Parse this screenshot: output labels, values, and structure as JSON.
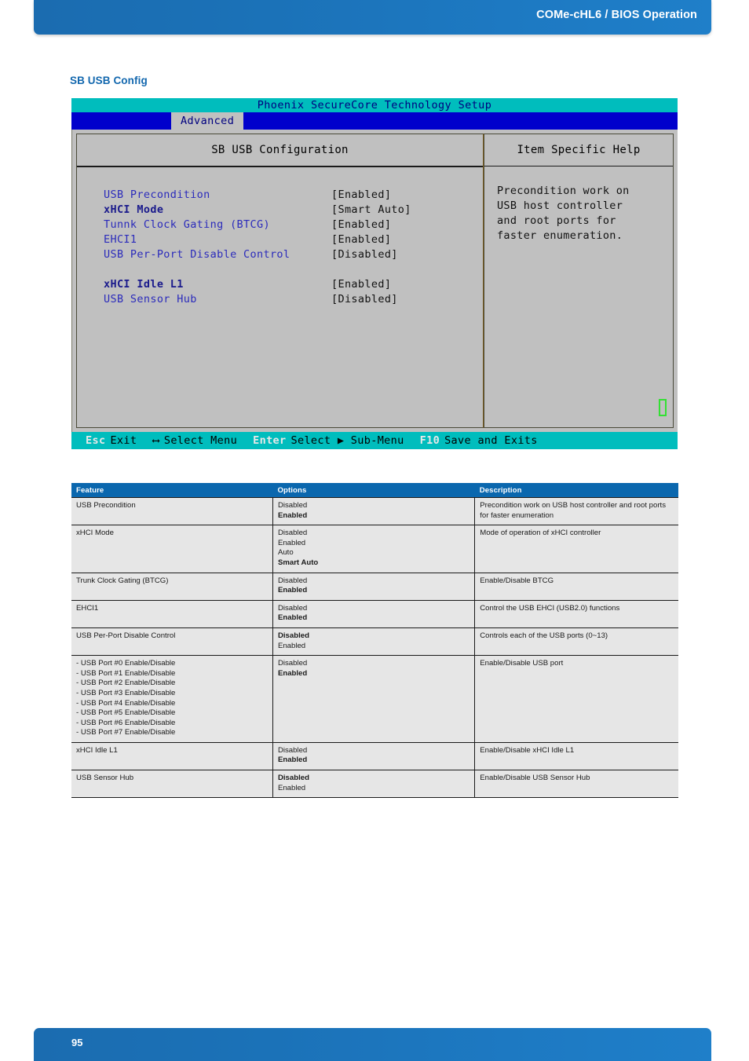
{
  "header": {
    "title": "COMe-cHL6 / BIOS Operation"
  },
  "section": {
    "heading": "SB USB Config"
  },
  "bios": {
    "titlebar": "Phoenix SecureCore Technology Setup",
    "active_tab": "Advanced",
    "left_panel_title": "SB USB Configuration",
    "right_panel_title": "Item Specific Help",
    "settings": [
      {
        "name": "USB Precondition",
        "value": "[Enabled]",
        "bold": false
      },
      {
        "name": "xHCI Mode",
        "value": "[Smart Auto]",
        "bold": true
      },
      {
        "name": "Tunnk Clock Gating (BTCG)",
        "value": "[Enabled]",
        "bold": false
      },
      {
        "name": "EHCI1",
        "value": "[Enabled]",
        "bold": false
      },
      {
        "name": "USB Per-Port Disable Control",
        "value": "[Disabled]",
        "bold": false
      },
      {
        "name": "",
        "value": "",
        "bold": false
      },
      {
        "name": "xHCI Idle L1",
        "value": "[Enabled]",
        "bold": true
      },
      {
        "name": "USB Sensor Hub",
        "value": "[Disabled]",
        "bold": false
      }
    ],
    "help_lines": [
      "Precondition work on",
      "USB host controller",
      "and root ports for",
      "faster enumeration."
    ],
    "footer": [
      {
        "key": "Esc",
        "label": "Exit"
      },
      {
        "key": "⟷",
        "label": "Select Menu"
      },
      {
        "key": "Enter",
        "label": "Select ▶ Sub-Menu"
      },
      {
        "key": "F10",
        "label": "Save and Exits"
      }
    ]
  },
  "table": {
    "columns": [
      "Feature",
      "Options",
      "Description"
    ],
    "rows": [
      {
        "feature": "USB Precondition",
        "options": [
          {
            "text": "Disabled",
            "bold": false
          },
          {
            "text": "Enabled",
            "bold": true
          }
        ],
        "description": "Precondition work on USB host controller and root ports for faster enumeration"
      },
      {
        "feature": "xHCI Mode",
        "options": [
          {
            "text": "Disabled",
            "bold": false
          },
          {
            "text": "Enabled",
            "bold": false
          },
          {
            "text": "Auto",
            "bold": false
          },
          {
            "text": "Smart Auto",
            "bold": true
          }
        ],
        "description": "Mode of operation of xHCI controller"
      },
      {
        "feature": "Trunk Clock Gating (BTCG)",
        "options": [
          {
            "text": "Disabled",
            "bold": false
          },
          {
            "text": "Enabled",
            "bold": true
          }
        ],
        "description": "Enable/Disable BTCG"
      },
      {
        "feature": "EHCI1",
        "options": [
          {
            "text": "Disabled",
            "bold": false
          },
          {
            "text": "Enabled",
            "bold": true
          }
        ],
        "description": "Control the USB EHCI (USB2.0) functions"
      },
      {
        "feature": "USB Per-Port Disable Control",
        "options": [
          {
            "text": "Disabled",
            "bold": true
          },
          {
            "text": "Enabled",
            "bold": false
          }
        ],
        "description": "Controls each of the USB ports (0~13)"
      },
      {
        "feature": "- USB Port #0 Enable/Disable\n- USB Port #1 Enable/Disable\n- USB Port #2 Enable/Disable\n- USB Port #3 Enable/Disable\n- USB Port #4 Enable/Disable\n- USB Port #5 Enable/Disable\n- USB Port #6 Enable/Disable\n- USB Port #7 Enable/Disable",
        "options": [
          {
            "text": "Disabled",
            "bold": false
          },
          {
            "text": "Enabled",
            "bold": true
          }
        ],
        "description": "Enable/Disable USB port"
      },
      {
        "feature": "xHCI Idle L1",
        "options": [
          {
            "text": "Disabled",
            "bold": false
          },
          {
            "text": "Enabled",
            "bold": true
          }
        ],
        "description": "Enable/Disable xHCI Idle L1"
      },
      {
        "feature": "USB Sensor Hub",
        "options": [
          {
            "text": "Disabled",
            "bold": true
          },
          {
            "text": "Enabled",
            "bold": false
          }
        ],
        "description": "Enable/Disable USB Sensor Hub"
      }
    ]
  },
  "footer": {
    "page_number": "95"
  },
  "colors": {
    "brand_blue": "#1b6cb0",
    "heading_blue": "#1267ae",
    "table_header_blue": "#0a67ae",
    "bios_teal": "#00bdbd",
    "bios_menu_blue": "#0000cc",
    "bios_grey": "#c0c0c0",
    "bios_label_blue": "#2b2bbb",
    "scroll_marker_green": "#33e033"
  }
}
